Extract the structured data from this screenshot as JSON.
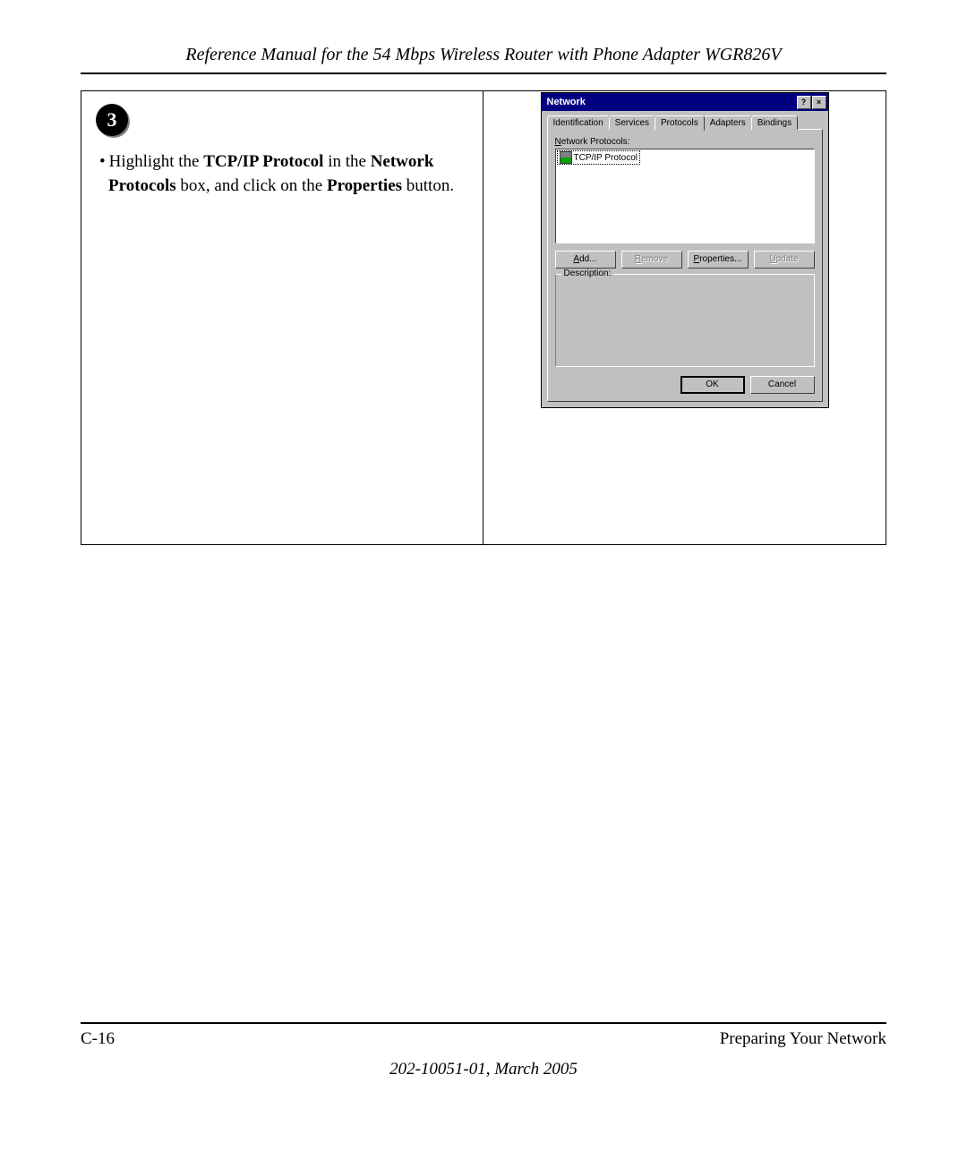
{
  "header": {
    "title": "Reference Manual for the 54 Mbps Wireless Router with Phone Adapter WGR826V"
  },
  "step": {
    "number": "3"
  },
  "instruction": {
    "bullet": "•",
    "part1": "Highlight the ",
    "bold1": "TCP/IP Protocol",
    "part2": " in the ",
    "bold2": "Network Protocols",
    "part3": " box, and click on the ",
    "bold3": "Properties",
    "part4": " button."
  },
  "dialog": {
    "title": "Network",
    "help": "?",
    "close": "×",
    "tabs": {
      "identification": "Identification",
      "services": "Services",
      "protocols": "Protocols",
      "adapters": "Adapters",
      "bindings": "Bindings"
    },
    "panel_label_prefix": "N",
    "panel_label_rest": "etwork Protocols:",
    "list_item": "TCP/IP Protocol",
    "buttons": {
      "add_u": "A",
      "add_rest": "dd...",
      "remove_u": "R",
      "remove_rest": "emove",
      "properties_u": "P",
      "properties_rest": "roperties...",
      "update_u": "U",
      "update_rest": "pdate"
    },
    "description_label": "Description:",
    "ok": "OK",
    "cancel": "Cancel"
  },
  "footer": {
    "page": "C-16",
    "section": "Preparing Your Network",
    "docid": "202-10051-01, March 2005"
  }
}
